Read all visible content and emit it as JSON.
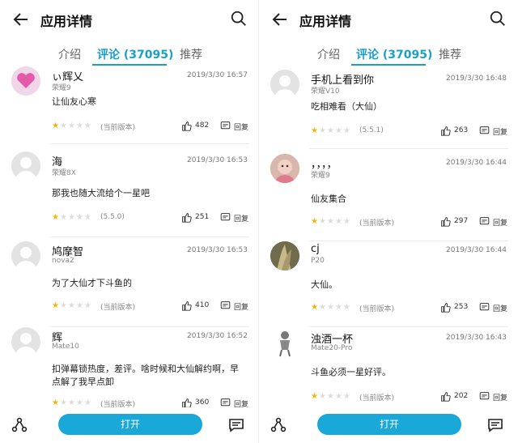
{
  "left": {
    "header": {
      "title": "应用详情"
    },
    "tabs": [
      "介绍",
      "评论 (37095)",
      "推荐"
    ],
    "comments": [
      {
        "name": "ぃ辉乂",
        "device": "荣耀9",
        "time": "2019/3/30 16:57",
        "text": "让仙友心寒",
        "stars": 1,
        "version": "(当前版本)",
        "likes": "482",
        "reply": "回复"
      },
      {
        "name": "海",
        "device": "荣耀8X",
        "time": "2019/3/30 16:53",
        "text": "那我也随大流给个一星吧",
        "stars": 1,
        "version": "(5.5.0)",
        "likes": "251",
        "reply": "回复"
      },
      {
        "name": "鸠摩智",
        "device": "nova2",
        "time": "2019/3/30 16:53",
        "text": "为了大仙才下斗鱼的",
        "stars": 1,
        "version": "(当前版本)",
        "likes": "410",
        "reply": "回复"
      },
      {
        "name": "辉",
        "device": "Mate10",
        "time": "2019/3/30 16:52",
        "text": "扣弹幕锁热度，差评。啥时候和大仙解约啊，早点解了我早点卸",
        "stars": 1,
        "version": "(当前版本)",
        "likes": "360",
        "reply": "回复"
      }
    ],
    "bottom": {
      "open_label": "打开"
    }
  },
  "right": {
    "header": {
      "title": "应用详情"
    },
    "tabs": [
      "介绍",
      "评论 (37095)",
      "推荐"
    ],
    "comments": [
      {
        "name": "手机上看到你",
        "device": "荣耀V10",
        "time": "2019/3/30 16:48",
        "text": "吃相难看（大仙）",
        "stars": 1,
        "version": "(5.5.1)",
        "likes": "263",
        "reply": "回复"
      },
      {
        "name": "，，，，",
        "device": "荣耀9",
        "time": "2019/3/30 16:44",
        "text": "仙友集合",
        "stars": 1,
        "version": "(当前版本)",
        "likes": "297",
        "reply": "回复"
      },
      {
        "name": "cj",
        "device": "P20",
        "time": "2019/3/30 16:44",
        "text": "大仙。",
        "stars": 1,
        "version": "(当前版本)",
        "likes": "253",
        "reply": "回复"
      },
      {
        "name": "浊酒一杯",
        "device": "Mate20-Pro",
        "time": "2019/3/30 16:43",
        "text": "斗鱼必须一星好评。",
        "stars": 1,
        "version": "(当前版本)",
        "likes": "202",
        "reply": "回复"
      }
    ],
    "bottom": {
      "open_label": "打开"
    }
  },
  "colors": {
    "accent": "#1aa0c8",
    "star": "#f7b500",
    "button": "#1aa8d8"
  },
  "icons": [
    "back-arrow-icon",
    "search-icon",
    "thumbs-up-icon",
    "reply-icon",
    "share-icon",
    "message-icon"
  ]
}
